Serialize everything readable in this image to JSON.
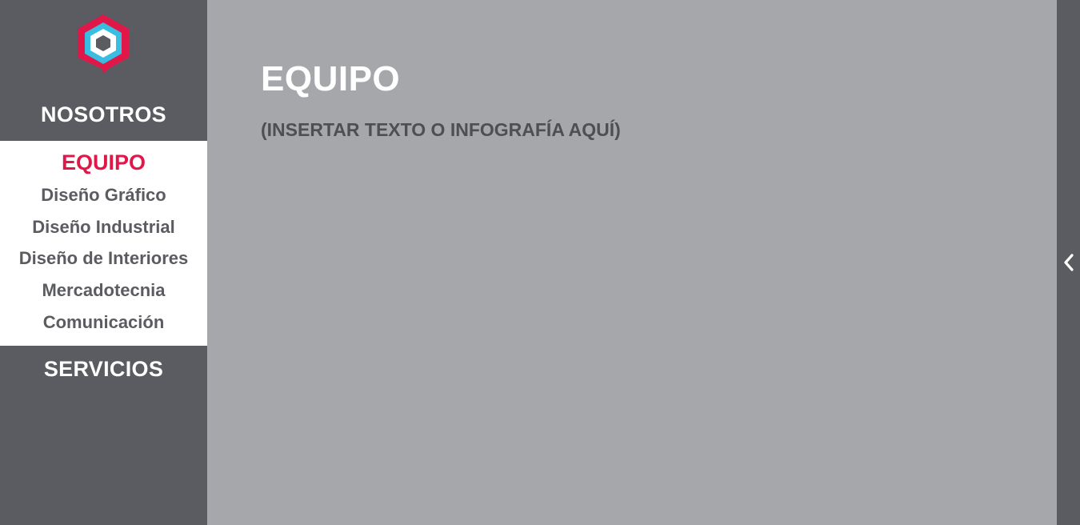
{
  "sidebar": {
    "logo_icon": "hexagon-logo-icon",
    "sections": {
      "nosotros": "NOSOTROS",
      "servicios": "SERVICIOS"
    },
    "submenu": {
      "active": "EQUIPO",
      "items": [
        "Diseño Gráfico",
        "Diseño Industrial",
        "Diseño de Interiores",
        "Mercadotecnia",
        "Comunicación"
      ]
    }
  },
  "main": {
    "title": "EQUIPO",
    "subtitle": "(INSERTAR TEXTO O INFOGRAFÍA AQUÍ)"
  },
  "right_panel": {
    "toggle_icon": "chevron-left-icon"
  },
  "colors": {
    "sidebar_bg": "#5b5c61",
    "main_bg": "#a6a7ab",
    "accent_red": "#e0184a",
    "accent_blue": "#39bde0"
  }
}
